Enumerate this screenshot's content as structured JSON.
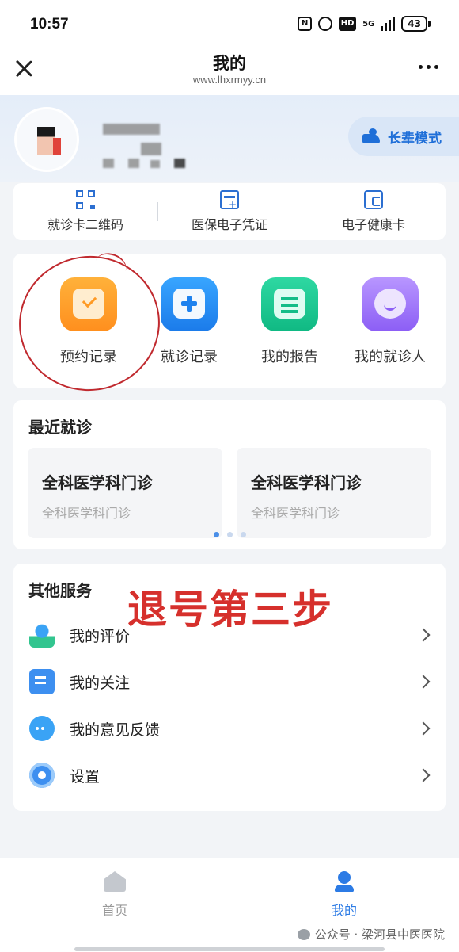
{
  "status_bar": {
    "time": "10:57",
    "network": "5G",
    "battery": "43"
  },
  "header": {
    "title": "我的",
    "url": "www.lhxrmyy.cn"
  },
  "profile": {
    "elder_mode_label": "长辈模式"
  },
  "quick_links": [
    {
      "label": "就诊卡二维码",
      "icon": "qr-code-icon"
    },
    {
      "label": "医保电子凭证",
      "icon": "insurance-card-icon"
    },
    {
      "label": "电子健康卡",
      "icon": "health-card-icon"
    }
  ],
  "services": [
    {
      "label": "预约记录",
      "icon": "calendar-check-icon"
    },
    {
      "label": "就诊记录",
      "icon": "medical-kit-icon"
    },
    {
      "label": "我的报告",
      "icon": "report-icon"
    },
    {
      "label": "我的就诊人",
      "icon": "patient-icon"
    }
  ],
  "recent": {
    "title": "最近就诊",
    "items": [
      {
        "title": "全科医学科门诊",
        "subtitle": "全科医学科门诊"
      },
      {
        "title": "全科医学科门诊",
        "subtitle": "全科医学科门诊"
      }
    ],
    "dots": 3,
    "active_dot": 0
  },
  "other": {
    "title": "其他服务",
    "annotation": "退号第三步",
    "items": [
      {
        "label": "我的评价",
        "icon": "rating-icon"
      },
      {
        "label": "我的关注",
        "icon": "follow-icon"
      },
      {
        "label": "我的意见反馈",
        "icon": "feedback-icon"
      },
      {
        "label": "设置",
        "icon": "settings-icon"
      }
    ]
  },
  "bottom_nav": {
    "items": [
      {
        "label": "首页",
        "icon": "home-icon",
        "active": false
      },
      {
        "label": "我的",
        "icon": "profile-icon",
        "active": true
      }
    ]
  },
  "watermark": "公众号 · 梁河县中医医院",
  "colors": {
    "accent": "#1f6fd8",
    "annotation_red": "#d6302c",
    "nav_active": "#2c7be5",
    "nav_inactive": "#999999"
  }
}
